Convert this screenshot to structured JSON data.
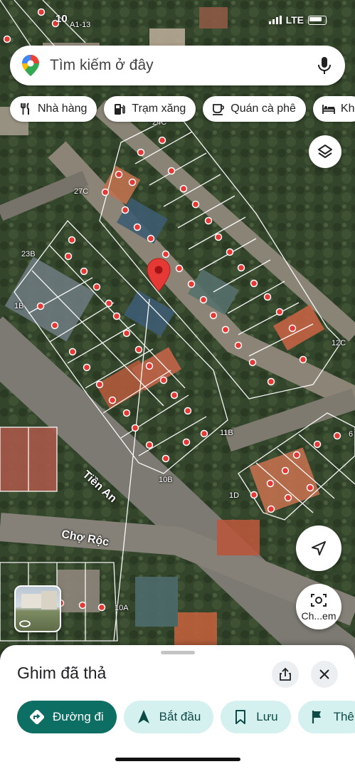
{
  "status_bar": {
    "time": "10",
    "network": "LTE"
  },
  "search": {
    "placeholder": "Tìm kiếm ở đây"
  },
  "chips": [
    {
      "label": "Nhà hàng",
      "icon": "restaurant-icon"
    },
    {
      "label": "Trạm xăng",
      "icon": "gas-station-icon"
    },
    {
      "label": "Quán cà phê",
      "icon": "coffee-icon"
    },
    {
      "label": "Kh",
      "icon": "hotel-icon"
    }
  ],
  "map": {
    "plot_labels": [
      "A1-13",
      "24C",
      "27C",
      "23B",
      "1B",
      "12C",
      "11B",
      "10B",
      "1D",
      "10A",
      "6"
    ],
    "road_labels": [
      "Tiền An",
      "Chợ Rộc"
    ],
    "marker_color": "#e53935"
  },
  "street_view_button": {
    "label": "Ch...em"
  },
  "sheet": {
    "title": "Ghim đã thả",
    "actions": [
      {
        "label": "Đường đi",
        "icon": "directions-icon",
        "style": "primary"
      },
      {
        "label": "Bắt đầu",
        "icon": "navigation-arrow-icon",
        "style": "secondary"
      },
      {
        "label": "Lưu",
        "icon": "bookmark-icon",
        "style": "secondary"
      },
      {
        "label": "Thê",
        "icon": "flag-icon",
        "style": "secondary"
      }
    ]
  },
  "colors": {
    "primary_action": "#0d6e64",
    "secondary_action": "#d5f1ef",
    "pin_red": "#e53935"
  }
}
